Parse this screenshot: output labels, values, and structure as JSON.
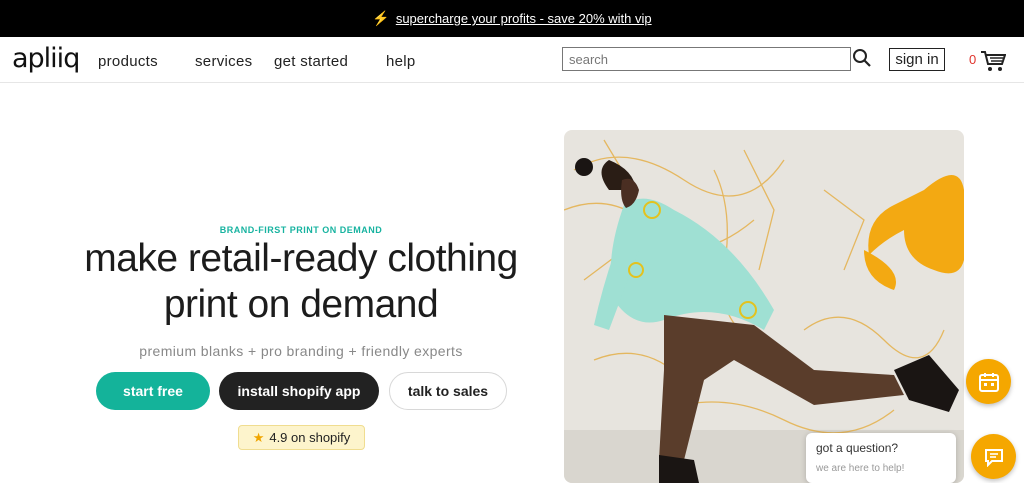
{
  "promo": {
    "text": "supercharge your profits - save 20% with vip"
  },
  "nav": {
    "logo": "apliiq",
    "links": [
      "products",
      "services",
      "get started",
      "help"
    ],
    "search_placeholder": "search",
    "signin": "sign in",
    "cart_count": "0"
  },
  "hero": {
    "eyebrow": "BRAND-FIRST PRINT ON DEMAND",
    "headline_line1": "make retail-ready clothing",
    "headline_line2": "print on demand",
    "subtitle": "premium blanks + pro branding + friendly experts",
    "buttons": {
      "start": "start free",
      "shopify": "install shopify app",
      "sales": "talk to sales"
    },
    "rating": "4.9 on shopify"
  },
  "chat": {
    "question": "got a question?",
    "sub": "we are here to help!"
  },
  "colors": {
    "accent": "#14b39a",
    "orange": "#f5a700",
    "dark": "#222222"
  }
}
